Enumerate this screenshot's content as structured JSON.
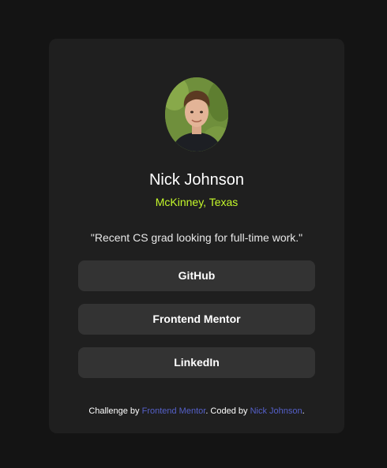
{
  "profile": {
    "name": "Nick Johnson",
    "location": "McKinney, Texas",
    "bio": "\"Recent CS grad looking for full-time work.\""
  },
  "links": [
    {
      "label": "GitHub"
    },
    {
      "label": "Frontend Mentor"
    },
    {
      "label": "LinkedIn"
    }
  ],
  "attribution": {
    "prefix": "Challenge by ",
    "challenge_link": "Frontend Mentor",
    "middle": ". Coded by ",
    "author_link": "Nick Johnson",
    "suffix": "."
  },
  "colors": {
    "page_background": "#141414",
    "card_background": "#1f1f1f",
    "button_background": "#333333",
    "accent_green": "#c4f82a",
    "link_blue": "#5560c9"
  }
}
